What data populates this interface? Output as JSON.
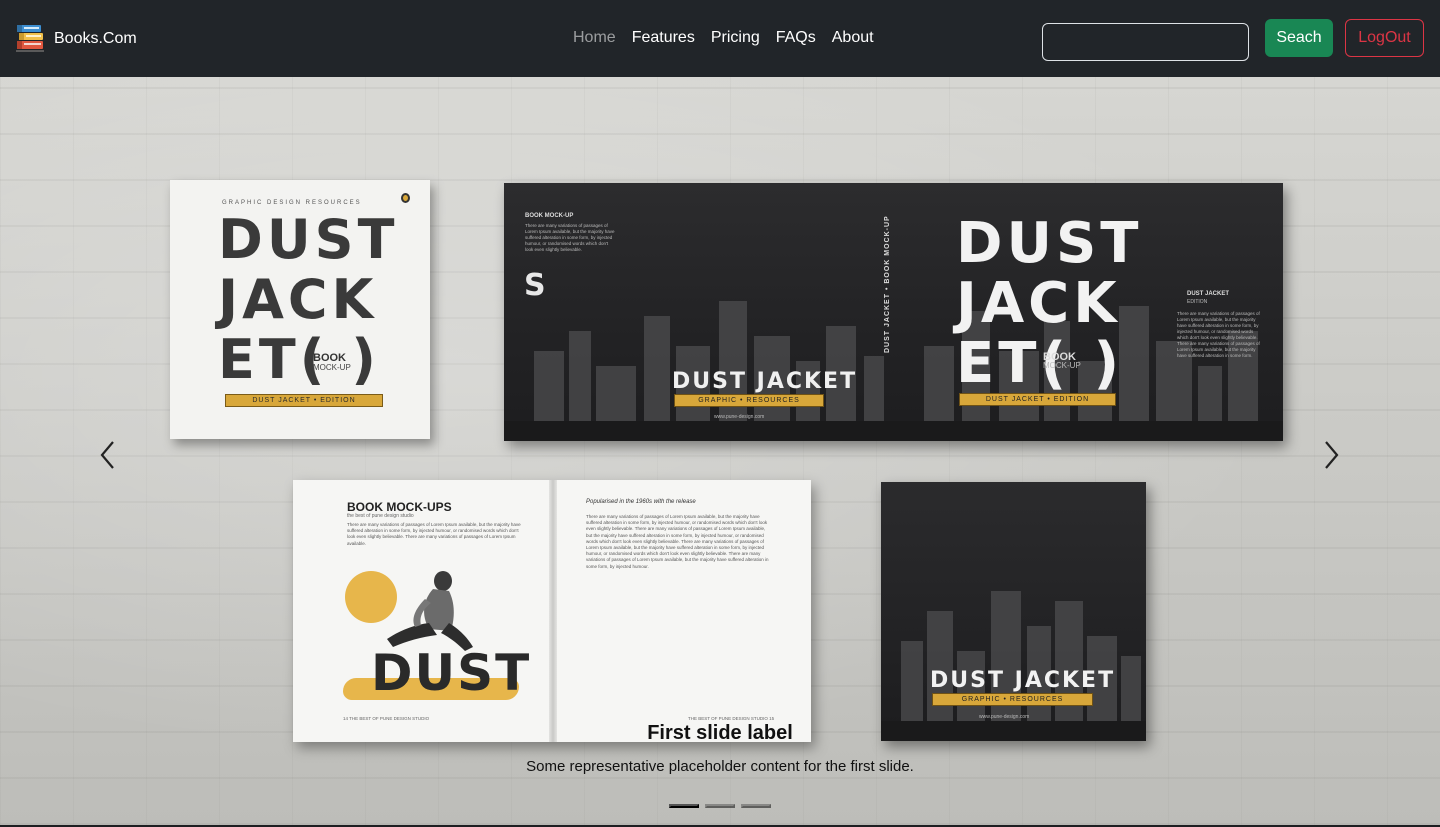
{
  "brand": {
    "name": "Books.Com",
    "icon": "books-stack-icon"
  },
  "nav": {
    "items": [
      {
        "label": "Home",
        "active": true
      },
      {
        "label": "Features",
        "active": false
      },
      {
        "label": "Pricing",
        "active": false
      },
      {
        "label": "FAQs",
        "active": false
      },
      {
        "label": "About",
        "active": false
      }
    ]
  },
  "search": {
    "value": "",
    "placeholder": "",
    "button_label": "Seach"
  },
  "auth": {
    "logout_label": "LogOut"
  },
  "colors": {
    "navbar_bg": "#212529",
    "search_button": "#198754",
    "logout_button": "#dc3545"
  },
  "carousel": {
    "slide": {
      "caption_title": "First slide label",
      "caption_text": "Some representative placeholder content for the first slide."
    },
    "active_index": 0,
    "indicator_count": 3,
    "prev_icon": "chevron-left-icon",
    "next_icon": "chevron-right-icon",
    "mockup": {
      "white_cover": {
        "top_text": "GRAPHIC DESIGN RESOURCES",
        "line1": "DUST",
        "line2": "JACK",
        "line3": "ET(  )",
        "book": "BOOK",
        "mockup": "MOCK-UP",
        "badge": "DUST JACKET • EDITION"
      },
      "jacket": {
        "back_label": "BOOK MOCK-UP",
        "back_text": "There are many variations of passages of Lorem Ipsum available, but the majority have suffered alteration in some form, by injected humour, or randomised words which don't look even slightly believable.",
        "back_letter": "S",
        "logo": "DUST JACKET",
        "logo_sub": "GRAPHIC • RESOURCES",
        "www": "www.pune-design.com",
        "spine": "DUST JACKET • BOOK MOCK-UP",
        "front_line1": "DUST",
        "front_line2": "JACK",
        "front_line3": "ET(  )",
        "front_book": "BOOK",
        "front_mockup": "MOCK-UP",
        "front_badge": "DUST JACKET • EDITION",
        "flap_title": "DUST JACKET",
        "flap_sub": "EDITION",
        "flap_text": "There are many variations of passages of Lorem Ipsum available, but the majority have suffered alteration in some form, by injected humour, or randomised words which don't look even slightly believable. There are many variations of passages of Lorem Ipsum available, but the majority have suffered alteration in some form."
      },
      "open_book": {
        "title": "BOOK MOCK-UPS",
        "subtitle": "the best of pune design studio",
        "left_text": "There are many variations of passages of Lorem Ipsum available, but the majority have suffered alteration in some form, by injected humour, or randomised words which don't look even slightly believable. There are many variations of passages of Lorem Ipsum available.",
        "dust": "DUST",
        "left_footer": "14  THE BEST OF PUNE DESIGN STUDIO",
        "right_heading": "Popularised in the 1960s with the release",
        "right_text": "There are many variations of passages of Lorem Ipsum available, but the majority have suffered alteration in some form, by injected humour, or randomised words which don't look even slightly believable. There are many variations of passages of Lorem Ipsum available, but the majority have suffered alteration in some form, by injected humour, or randomised words which don't look even slightly believable. There are many variations of passages of Lorem Ipsum available, but the majority have suffered alteration in some form, by injected humour, or randomised words which don't look even slightly believable. There are many variations of passages of Lorem Ipsum available, but the majority have suffered alteration in some form, by injected humour.",
        "right_footer": "THE BEST OF PUNE DESIGN STUDIO  15"
      },
      "dark_cover": {
        "logo": "DUST JACKET",
        "logo_sub": "GRAPHIC • RESOURCES",
        "www": "www.pune-design.com"
      }
    }
  }
}
